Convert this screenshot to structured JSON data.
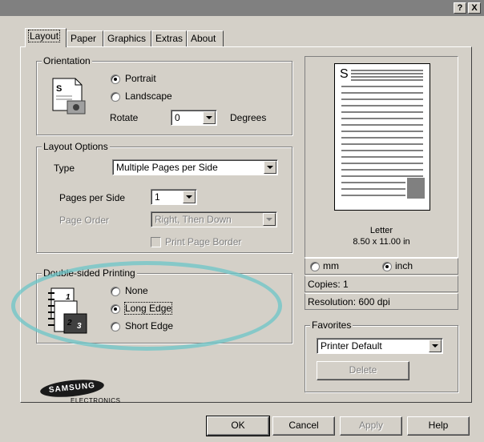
{
  "title_buttons": {
    "help": "?",
    "close": "X"
  },
  "tabs": [
    {
      "label": "Layout",
      "active": true
    },
    {
      "label": "Paper"
    },
    {
      "label": "Graphics"
    },
    {
      "label": "Extras"
    },
    {
      "label": "About"
    }
  ],
  "orientation": {
    "group_label": "Orientation",
    "portrait": "Portrait",
    "landscape": "Landscape",
    "selected": "Portrait",
    "rotate_label": "Rotate",
    "rotate_value": "0",
    "degrees_label": "Degrees"
  },
  "layout_options": {
    "group_label": "Layout Options",
    "type_label": "Type",
    "type_value": "Multiple Pages per Side",
    "pages_per_side_label": "Pages per Side",
    "pages_per_side_value": "1",
    "page_order_label": "Page Order",
    "page_order_value": "Right, Then Down",
    "print_page_border_label": "Print Page Border"
  },
  "double_sided": {
    "group_label": "Double-sided Printing",
    "none": "None",
    "long_edge": "Long Edge",
    "short_edge": "Short Edge",
    "selected": "Long Edge"
  },
  "preview": {
    "page_letter": "S",
    "paper_name": "Letter",
    "paper_size": "8.50 x 11.00 in",
    "unit_mm": "mm",
    "unit_inch": "inch",
    "selected_unit": "inch",
    "copies": "Copies: 1",
    "resolution": "Resolution: 600 dpi"
  },
  "favorites": {
    "group_label": "Favorites",
    "selected": "Printer Default",
    "delete_label": "Delete"
  },
  "logo": {
    "brand": "SAMSUNG",
    "sub": "ELECTRONICS"
  },
  "buttons": {
    "ok": "OK",
    "cancel": "Cancel",
    "apply": "Apply",
    "help": "Help"
  },
  "colors": {
    "highlight_ellipse": "#6cc5c8",
    "dialog_bg": "#d4d0c8",
    "titlebar": "#808080"
  }
}
